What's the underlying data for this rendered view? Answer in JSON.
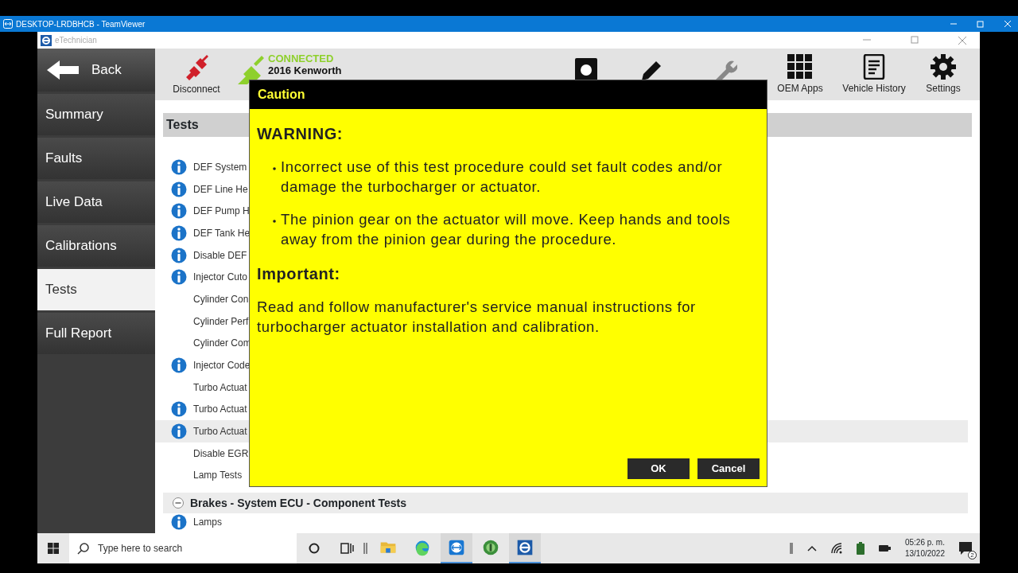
{
  "window": {
    "title": "DESKTOP-LRDBHCB - TeamViewer"
  },
  "app": {
    "title": "eTechnician"
  },
  "sidebar": {
    "back": "Back",
    "items": [
      {
        "label": "Summary",
        "selected": false
      },
      {
        "label": "Faults",
        "selected": false
      },
      {
        "label": "Live Data",
        "selected": false
      },
      {
        "label": "Calibrations",
        "selected": false
      },
      {
        "label": "Tests",
        "selected": true
      },
      {
        "label": "Full Report",
        "selected": false
      }
    ]
  },
  "toolbar": {
    "disconnect": "Disconnect",
    "status": {
      "state": "CONNECTED",
      "vehicle": "2016 Kenworth"
    },
    "tools": [
      {
        "kind": "camera",
        "disabled": false
      },
      {
        "kind": "pencil",
        "disabled": false
      },
      {
        "kind": "wrench",
        "disabled": true
      },
      {
        "kind": "apps",
        "label": "OEM Apps",
        "disabled": false
      },
      {
        "kind": "history",
        "label": "Vehicle History",
        "disabled": false
      },
      {
        "kind": "settings",
        "label": "Settings",
        "disabled": false
      }
    ]
  },
  "content": {
    "title": "Tests",
    "tests": [
      {
        "label": "DEF System",
        "info": true,
        "selected": false
      },
      {
        "label": "DEF Line He",
        "info": true,
        "selected": false
      },
      {
        "label": "DEF Pump H",
        "info": true,
        "selected": false
      },
      {
        "label": "DEF Tank He",
        "info": true,
        "selected": false
      },
      {
        "label": "Disable DEF",
        "info": true,
        "selected": false
      },
      {
        "label": "Injector Cuto",
        "info": true,
        "selected": false
      },
      {
        "label": "Cylinder Con",
        "info": false,
        "selected": false
      },
      {
        "label": "Cylinder Perf",
        "info": false,
        "selected": false
      },
      {
        "label": "Cylinder Com",
        "info": false,
        "selected": false
      },
      {
        "label": "Injector Code",
        "info": true,
        "selected": false
      },
      {
        "label": "Turbo Actuat",
        "info": false,
        "selected": false
      },
      {
        "label": "Turbo Actuat",
        "info": true,
        "selected": false
      },
      {
        "label": "Turbo Actuat",
        "info": true,
        "selected": true
      },
      {
        "label": "Disable EGR",
        "info": false,
        "selected": false
      },
      {
        "label": "Lamp Tests",
        "info": false,
        "selected": false
      }
    ],
    "sections": [
      {
        "title": "Brakes - System ECU - Component Tests",
        "expanded": true,
        "tests": [
          {
            "label": "Lamps",
            "info": true,
            "selected": false
          }
        ]
      }
    ]
  },
  "dialog": {
    "title": "Caution",
    "blocks": [
      {
        "kind": "heading",
        "text": "WARNING:"
      },
      {
        "kind": "bullet",
        "text": "Incorrect use of this test procedure could set fault codes and/or damage the turbocharger or actuator."
      },
      {
        "kind": "bullet",
        "text": "The pinion gear on the actuator will move. Keep hands and tools away from the pinion gear during the procedure."
      },
      {
        "kind": "heading",
        "text": "Important:"
      },
      {
        "kind": "paragraph",
        "text": "Read and follow manufacturer's service manual instructions for turbocharger actuator installation and calibration."
      }
    ],
    "buttons": [
      "OK",
      "Cancel"
    ]
  },
  "taskbar": {
    "placeholder": "Type here to search",
    "apps": [
      {
        "kind": "explorer",
        "active": false
      },
      {
        "kind": "edge",
        "active": false
      },
      {
        "kind": "teamviewer",
        "active": true
      },
      {
        "kind": "green",
        "active": false
      },
      {
        "kind": "etech",
        "active": true
      }
    ],
    "time": "05:26 p. m.",
    "date": "13/10/2022",
    "notifications": "2"
  }
}
